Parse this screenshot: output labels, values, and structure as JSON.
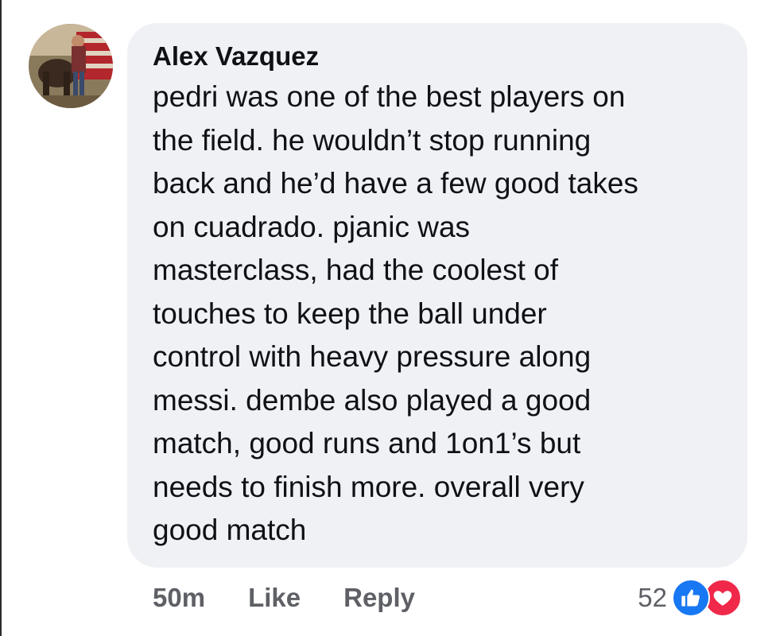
{
  "comment": {
    "author": "Alex Vazquez",
    "text": "pedri was one of the best players on\nthe field. he wouldn’t stop running\nback and he’d have a few good takes\non cuadrado. pjanic was\nmasterclass, had the coolest of\ntouches to keep the ball under\ncontrol with heavy pressure along\nmessi. dembe also played a good\nmatch, good runs and 1on1’s but\nneeds to finish more. overall very\ngood match",
    "avatar_icon": "profile-photo-avatar"
  },
  "actions": {
    "timestamp": "50m",
    "like_label": "Like",
    "reply_label": "Reply"
  },
  "reactions": {
    "count": "52",
    "icons": [
      "like-reaction-icon",
      "love-reaction-icon"
    ],
    "colors": {
      "like": "#1877f2",
      "love": "#f02849"
    }
  },
  "theme": {
    "bubble_bg": "#eff1f4",
    "text_color": "#101114",
    "meta_color": "#5e6066"
  }
}
